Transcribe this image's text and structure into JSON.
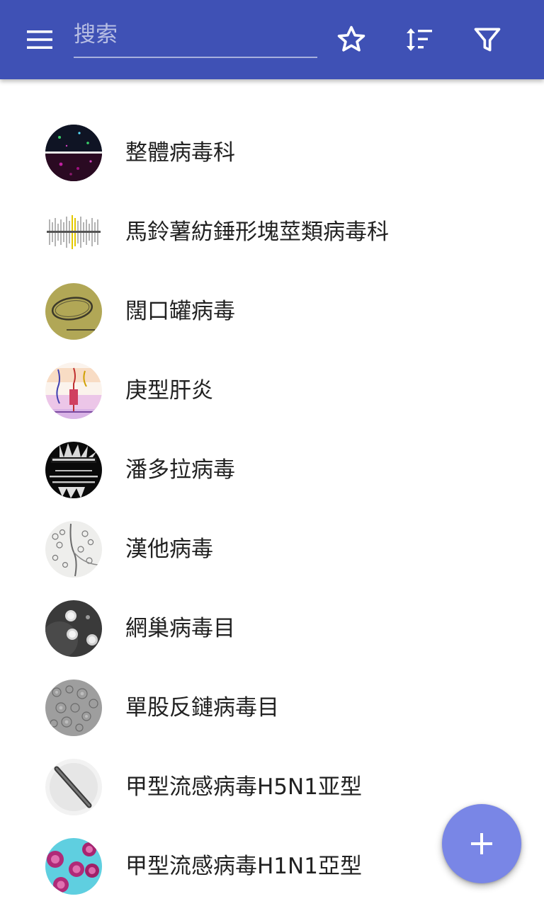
{
  "toolbar": {
    "search_placeholder": "搜索",
    "background_color": "#3f51b5",
    "icons": [
      "menu-icon",
      "star-outline-icon",
      "sort-icon",
      "filter-icon"
    ]
  },
  "list": {
    "items": [
      {
        "label": "整體病毒科",
        "thumbnail": "fluorescence-micrograph"
      },
      {
        "label": "馬鈴薯紡錘形塊莖類病毒科",
        "thumbnail": "gel-bands"
      },
      {
        "label": "闊口罐病毒",
        "thumbnail": "olive-micrograph"
      },
      {
        "label": "庚型肝炎",
        "thumbnail": "diagram"
      },
      {
        "label": "潘多拉病毒",
        "thumbnail": "black-white-poster"
      },
      {
        "label": "漢他病毒",
        "thumbnail": "em-sketch"
      },
      {
        "label": "網巢病毒目",
        "thumbnail": "em-particles"
      },
      {
        "label": "單股反鏈病毒目",
        "thumbnail": "gray-tissue"
      },
      {
        "label": "甲型流感病毒H5N1亚型",
        "thumbnail": "rod-particle"
      },
      {
        "label": "甲型流感病毒H1N1亞型",
        "thumbnail": "stained-virions"
      }
    ]
  },
  "fab": {
    "icon": "plus-icon",
    "color": "#7986e6"
  }
}
